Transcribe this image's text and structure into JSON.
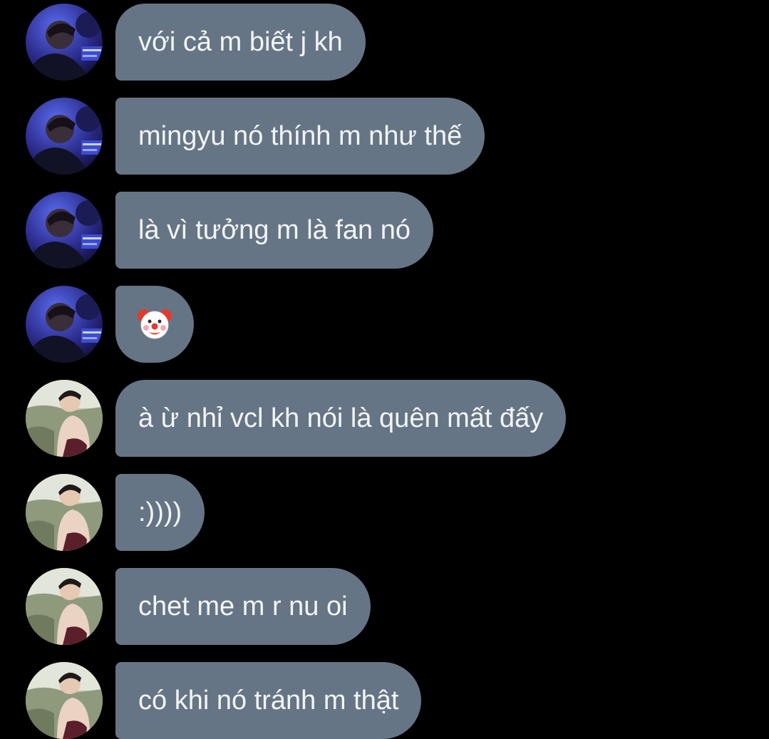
{
  "messages": [
    {
      "sender": "contact-a",
      "text": "với cả m biết j kh"
    },
    {
      "sender": "contact-a",
      "text": "mingyu nó thính m như thế"
    },
    {
      "sender": "contact-a",
      "text": "là vì tưởng m là fan nó"
    },
    {
      "sender": "contact-a",
      "emoji": "clown-face-icon"
    },
    {
      "sender": "contact-b",
      "text": "à ừ nhỉ vcl kh nói là quên mất đấy"
    },
    {
      "sender": "contact-b",
      "text": ":))))"
    },
    {
      "sender": "contact-b",
      "text": "chet me m r nu oi"
    },
    {
      "sender": "contact-b",
      "text": "có khi nó tránh m thật"
    }
  ],
  "colors": {
    "background": "#000000",
    "bubble": "#667585",
    "bubble_text": "#f2f4f6"
  }
}
